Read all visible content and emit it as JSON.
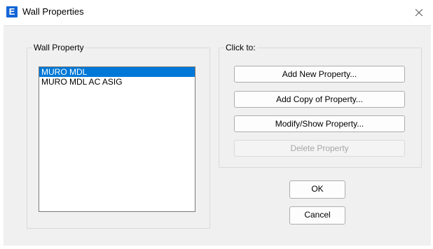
{
  "window": {
    "title": "Wall Properties",
    "app_icon_letter": "E",
    "icon_color": "#1366d6"
  },
  "wall_property": {
    "label": "Wall Property",
    "items": [
      {
        "label": "MURO MDL",
        "selected": true
      },
      {
        "label": "MURO MDL AC ASIG",
        "selected": false
      }
    ],
    "selection_color": "#0078d7"
  },
  "click_to": {
    "label": "Click to:",
    "buttons": [
      {
        "label": "Add New Property...",
        "enabled": true
      },
      {
        "label": "Add Copy of Property...",
        "enabled": true
      },
      {
        "label": "Modify/Show Property...",
        "enabled": true
      },
      {
        "label": "Delete Property",
        "enabled": false
      }
    ]
  },
  "dialog_buttons": {
    "ok_label": "OK",
    "cancel_label": "Cancel"
  }
}
